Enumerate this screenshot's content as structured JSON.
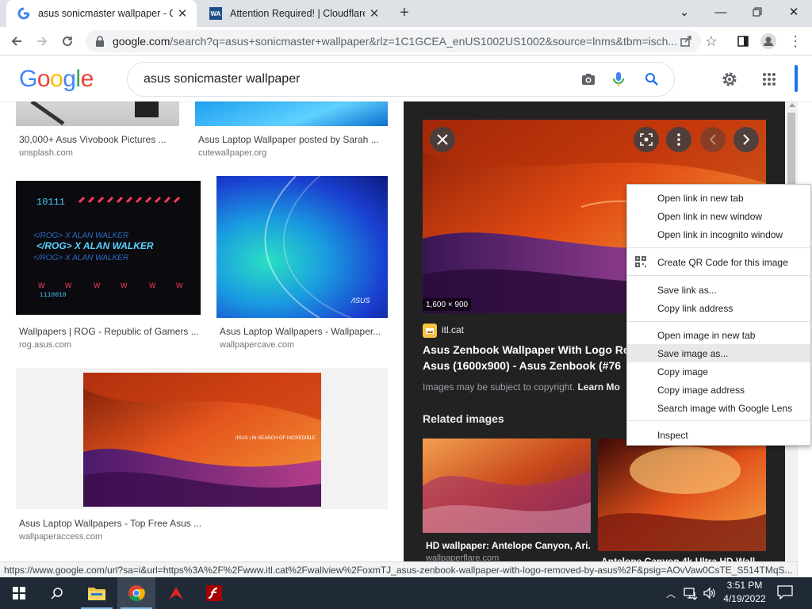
{
  "browser": {
    "tabs": [
      {
        "title": "asus sonicmaster wallpaper - Go",
        "active": true,
        "favicon": "google-g-icon"
      },
      {
        "title": "Attention Required! | Cloudflare",
        "active": false,
        "favicon": "wa-icon",
        "favicon_text": "WA"
      }
    ],
    "new_tab_symbol": "+",
    "url_host": "google.com",
    "url_rest": "/search?q=asus+sonicmaster+wallpaper&rlz=1C1GCEA_enUS1002US1002&source=lnms&tbm=isch..."
  },
  "google": {
    "logo_letters": [
      "G",
      "o",
      "o",
      "g",
      "l",
      "e"
    ],
    "logo_colors": [
      "#4285f4",
      "#ea4335",
      "#fbbc05",
      "#4285f4",
      "#34a853",
      "#ea4335"
    ],
    "query": "asus sonicmaster wallpaper"
  },
  "results": [
    {
      "title": "30,000+ Asus Vivobook Pictures ...",
      "source": "unsplash.com"
    },
    {
      "title": "Asus Laptop Wallpaper posted by Sarah ...",
      "source": "cutewallpaper.org"
    },
    {
      "title": "Wallpapers | ROG - Republic of Gamers ...",
      "source": "rog.asus.com",
      "image_text": "</ROG> X ALAN WALKER"
    },
    {
      "title": "Asus Laptop Wallpapers - Wallpaper...",
      "source": "wallpapercave.com",
      "image_text": "/ISUS"
    },
    {
      "title": "Asus Laptop Wallpapers - Top Free Asus ...",
      "source": "wallpaperaccess.com",
      "image_text": "/ISUS | IN SEARCH OF INCREDIBLE"
    }
  ],
  "preview": {
    "dimensions": "1,600 × 900",
    "site": "itl.cat",
    "title_line1": "Asus Zenbook Wallpaper With Logo Re",
    "title_line2": "Asus (1600x900) - Asus Zenbook (#76",
    "copyright": "Images may be subject to copyright.",
    "learn_more": "Learn Mo",
    "related_heading": "Related images",
    "related": [
      {
        "title": "HD wallpaper: Antelope Canyon, Ari...",
        "source": "wallpaperflare.com"
      },
      {
        "title": "Antelope Canyon 4k Ultra HD Wall...",
        "source": ""
      }
    ]
  },
  "context_menu": {
    "items": [
      {
        "label": "Open link in new tab"
      },
      {
        "label": "Open link in new window"
      },
      {
        "label": "Open link in incognito window"
      },
      {
        "label": "Create QR Code for this image",
        "icon": "qr-code-icon"
      },
      {
        "label": "Save link as..."
      },
      {
        "label": "Copy link address"
      },
      {
        "label": "Open image in new tab"
      },
      {
        "label": "Save image as...",
        "highlighted": true
      },
      {
        "label": "Copy image"
      },
      {
        "label": "Copy image address"
      },
      {
        "label": "Search image with Google Lens"
      },
      {
        "label": "Inspect"
      }
    ]
  },
  "status_url": "https://www.google.com/url?sa=i&url=https%3A%2F%2Fwww.itl.cat%2Fwallview%2FoxmTJ_asus-zenbook-wallpaper-with-logo-removed-by-asus%2F&psig=AOvVaw0CsTE_S514TMqS...",
  "taskbar": {
    "time": "3:51 PM",
    "date": "4/19/2022",
    "apps": [
      "file-explorer-icon",
      "chrome-icon",
      "acrobat-icon",
      "flash-icon"
    ]
  },
  "colors": {
    "accent_blue": "#1a73e8",
    "panel_bg": "#222222",
    "taskbar_bg": "#1f2a36"
  }
}
